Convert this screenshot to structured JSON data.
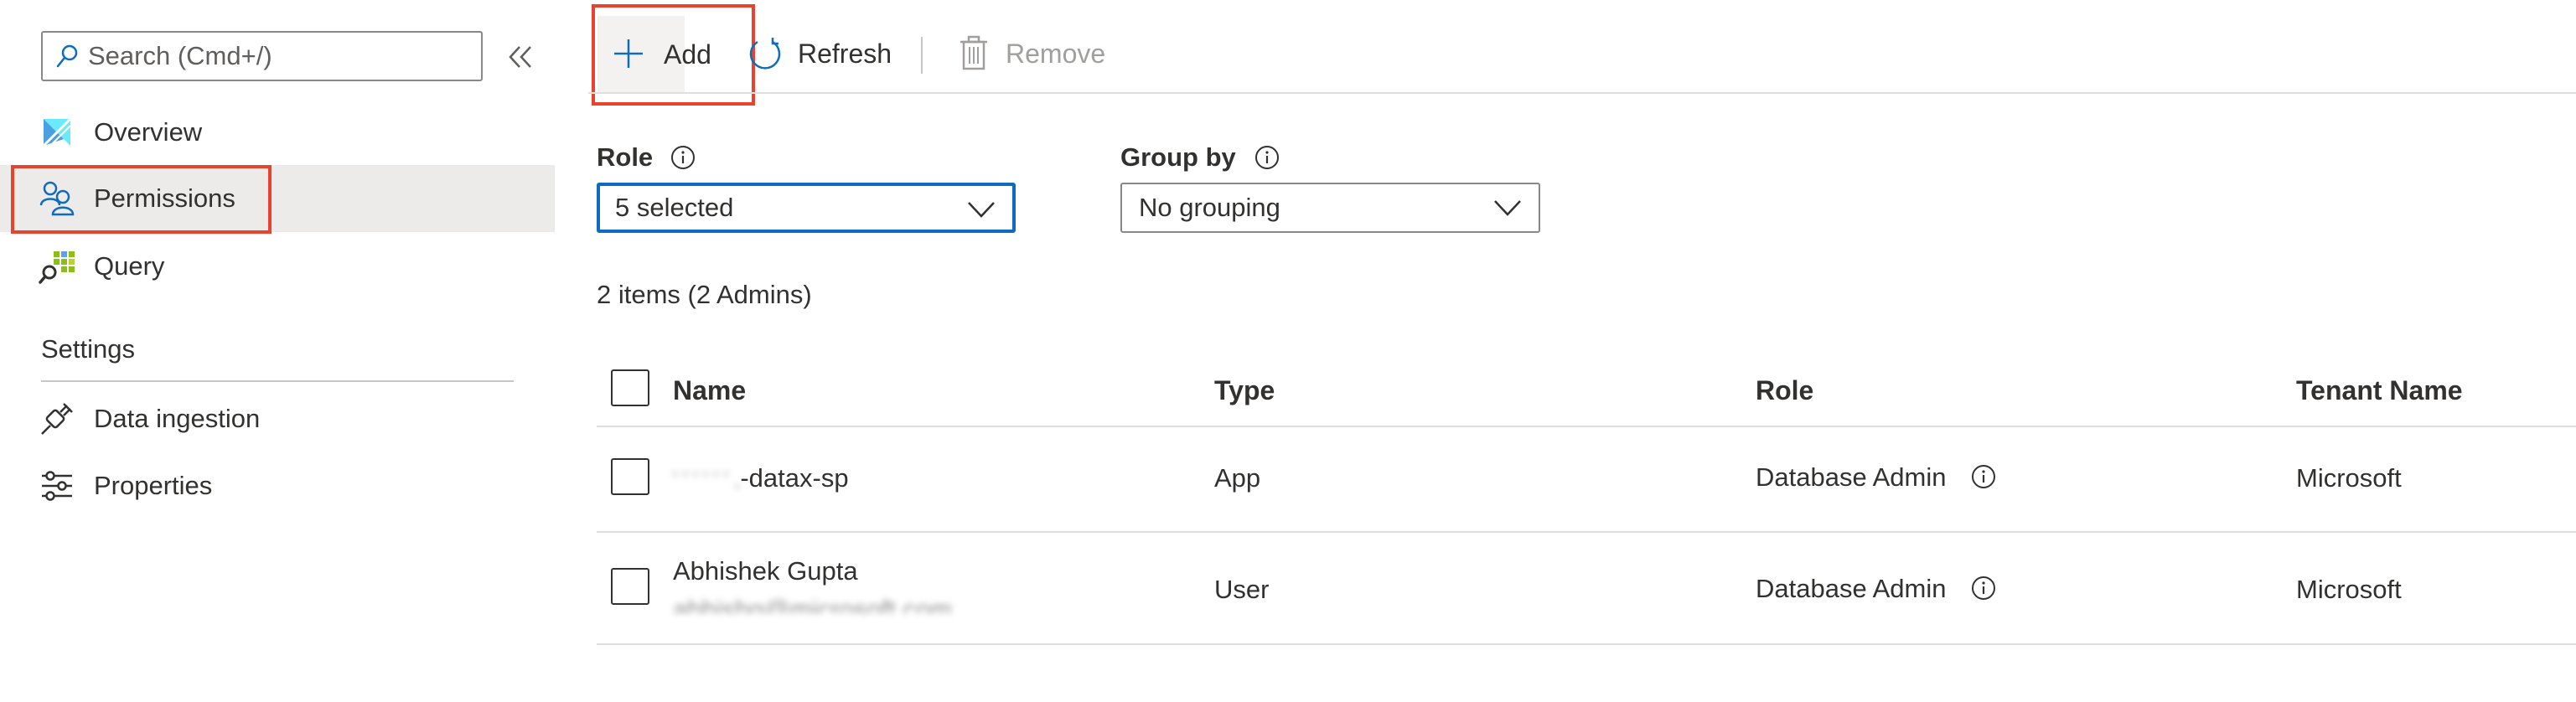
{
  "sidebar": {
    "search_placeholder": "Search (Cmd+/)",
    "collapse_glyph": "«",
    "items": [
      {
        "label": "Overview",
        "icon": "overview-icon"
      },
      {
        "label": "Permissions",
        "icon": "permissions-icon",
        "selected": true
      },
      {
        "label": "Query",
        "icon": "query-icon"
      }
    ],
    "settings": {
      "header": "Settings",
      "items": [
        {
          "label": "Data ingestion",
          "icon": "data-ingestion-icon"
        },
        {
          "label": "Properties",
          "icon": "properties-icon"
        }
      ]
    }
  },
  "toolbar": {
    "add_label": "Add",
    "refresh_label": "Refresh",
    "remove_label": "Remove",
    "remove_disabled": true
  },
  "filters": {
    "role_label": "Role",
    "role_value": "5 selected",
    "group_label": "Group by",
    "group_value": "No grouping"
  },
  "summary": "2 items (2 Admins)",
  "table": {
    "columns": [
      "Name",
      "Type",
      "Role",
      "Tenant Name"
    ],
    "rows": [
      {
        "name": "-datax-sp",
        "name_redacted_prefix": "' ' ' ' ' ' ,",
        "type": "App",
        "role": "Database Admin",
        "tenant": "Microsoft"
      },
      {
        "name": "Abhishek Gupta",
        "name_secondary": "abhishg@microsoft.com",
        "type": "User",
        "role": "Database Admin",
        "tenant": "Microsoft"
      }
    ]
  },
  "colors": {
    "accent": "#0f6cbd",
    "highlight_border": "#e8432f",
    "selected_bg": "#edebe9",
    "text": "#323130",
    "disabled_text": "#a19f9d"
  }
}
